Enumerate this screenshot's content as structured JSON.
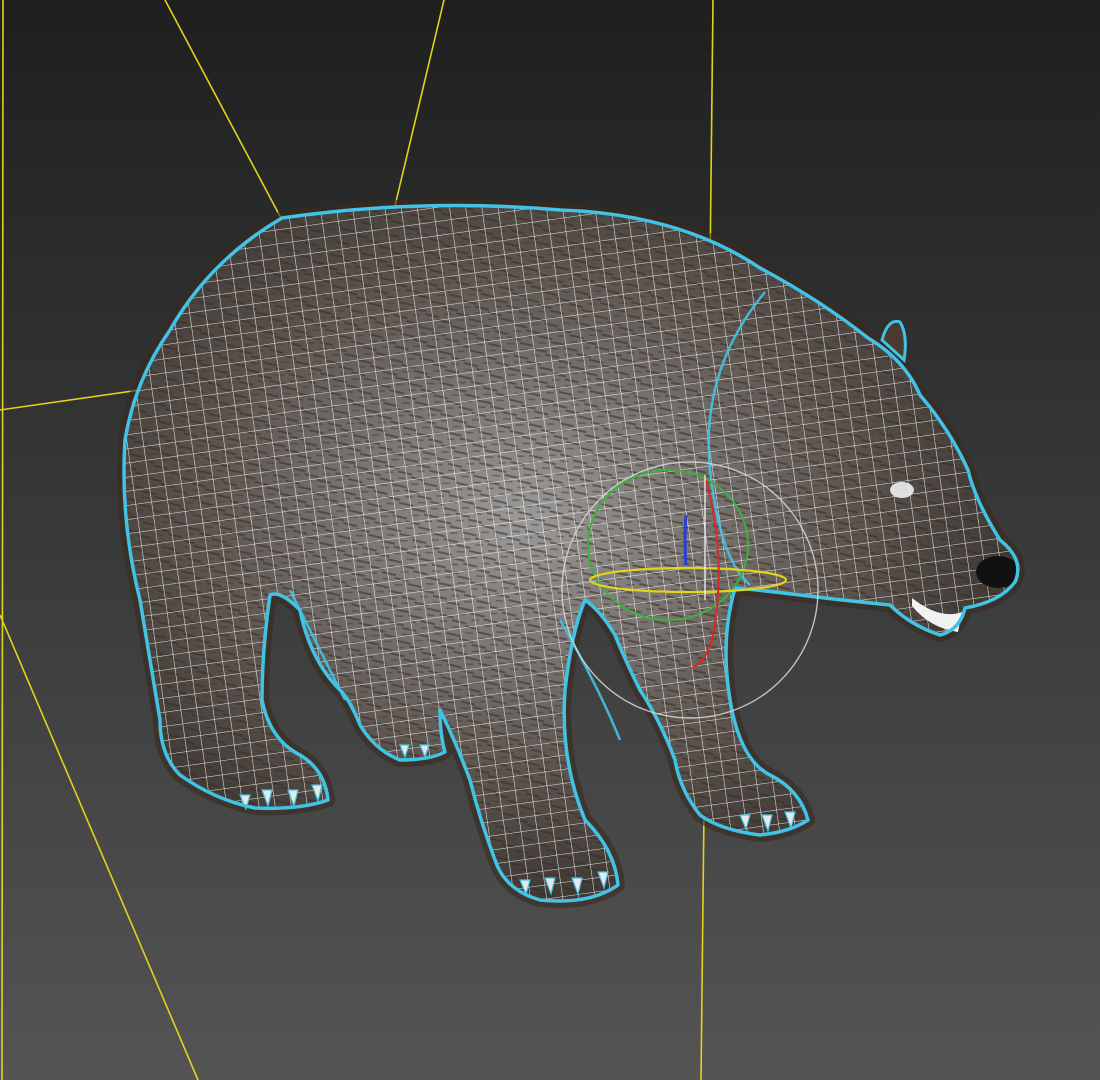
{
  "viewport": {
    "background_top": "#1e1f1f",
    "background_bottom": "#545454",
    "selection_outline_color": "#41c3e6",
    "wireframe_color": "#ffffff",
    "spline_color": "#e3d21a",
    "fur_color": "#3b2a1f",
    "body_shade_light": "#9a9a9a",
    "body_shade_dark": "#2e2a27"
  },
  "model": {
    "name": "bear-mesh",
    "display_mode": "shaded-wireframe",
    "selected": true
  },
  "gizmo": {
    "type": "rotate-gizmo",
    "axis_colors": {
      "x": "#d42a2a",
      "y": "#3bb23b",
      "z": "#2a3fd4",
      "view": "#d8d8d8",
      "screen": "#e6d21c"
    }
  }
}
